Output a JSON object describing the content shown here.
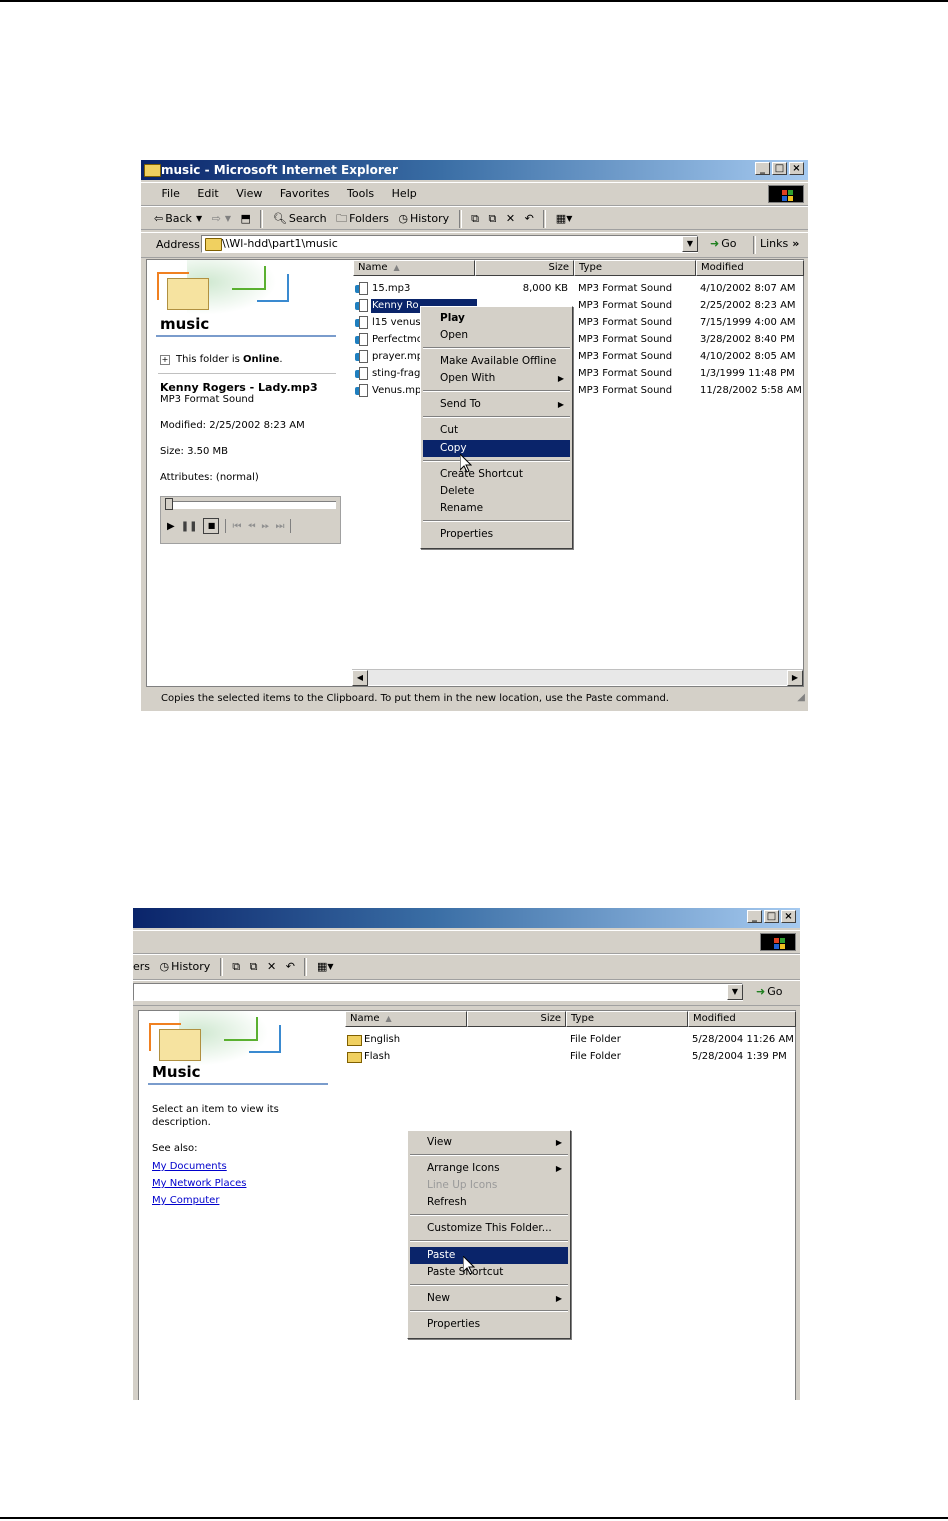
{
  "explorer1": {
    "title": "music - Microsoft Internet Explorer",
    "window_buttons": [
      "_",
      "□",
      "×"
    ],
    "menu": [
      "File",
      "Edit",
      "View",
      "Favorites",
      "Tools",
      "Help"
    ],
    "toolbar": {
      "back": "Back",
      "search": "Search",
      "folders": "Folders",
      "history": "History"
    },
    "address": {
      "label": "Address",
      "value": "\\\\Wl-hdd\\part1\\music",
      "go": "Go",
      "links": "Links"
    },
    "sidebar": {
      "folder_title": "music",
      "online_prefix": "This folder is ",
      "online_status": "Online",
      "online_suffix": ".",
      "selected_name": "Kenny Rogers - Lady.mp3",
      "selected_type": "MP3 Format Sound",
      "modified": "Modified: 2/25/2002 8:23 AM",
      "size": "Size: 3.50 MB",
      "attributes": "Attributes: (normal)"
    },
    "columns": [
      "Name",
      "Size",
      "Type",
      "Modified"
    ],
    "files": [
      {
        "name": "15.mp3",
        "size": "8,000 KB",
        "type": "MP3 Format Sound",
        "modified": "4/10/2002 8:07 AM"
      },
      {
        "name": "Kenny Ro",
        "size": "",
        "type": "MP3 Format Sound",
        "modified": "2/25/2002 8:23 AM"
      },
      {
        "name": "l15 venus",
        "size": "",
        "type": "MP3 Format Sound",
        "modified": "7/15/1999 4:00 AM"
      },
      {
        "name": "Perfectmc",
        "size": "",
        "type": "MP3 Format Sound",
        "modified": "3/28/2002 8:40 PM"
      },
      {
        "name": "prayer.mp",
        "size": "",
        "type": "MP3 Format Sound",
        "modified": "4/10/2002 8:05 AM"
      },
      {
        "name": "sting-frag",
        "size": "",
        "type": "MP3 Format Sound",
        "modified": "1/3/1999 11:48 PM"
      },
      {
        "name": "Venus.mp",
        "size": "",
        "type": "MP3 Format Sound",
        "modified": "11/28/2002 5:58 AM"
      }
    ],
    "context_menu": {
      "play": "Play",
      "open": "Open",
      "make_offline": "Make Available Offline",
      "open_with": "Open With",
      "send_to": "Send To",
      "cut": "Cut",
      "copy": "Copy",
      "create_shortcut": "Create Shortcut",
      "delete": "Delete",
      "rename": "Rename",
      "properties": "Properties"
    },
    "status": "Copies the selected items to the Clipboard. To put them in the new location, use the Paste command."
  },
  "explorer2": {
    "toolbar": {
      "folders_partial": "ers",
      "history": "History"
    },
    "go": "Go",
    "sidebar": {
      "folder_title": "Music",
      "description": [
        "Select an item to view its",
        "description."
      ],
      "see_also": "See also:",
      "links": [
        "My Documents",
        "My Network Places",
        "My Computer"
      ]
    },
    "columns": [
      "Name",
      "Size",
      "Type",
      "Modified"
    ],
    "files": [
      {
        "name": "English",
        "type": "File Folder",
        "modified": "5/28/2004 11:26 AM"
      },
      {
        "name": "Flash",
        "type": "File Folder",
        "modified": "5/28/2004 1:39 PM"
      }
    ],
    "context_menu": {
      "view": "View",
      "arrange_icons": "Arrange Icons",
      "line_up_icons": "Line Up Icons",
      "refresh": "Refresh",
      "customize": "Customize This Folder...",
      "paste": "Paste",
      "paste_shortcut": "Paste Shortcut",
      "new": "New",
      "properties": "Properties"
    }
  },
  "colors": {
    "title_active": "#0a246a",
    "selection": "#0a246a",
    "face": "#d4d0c8"
  }
}
